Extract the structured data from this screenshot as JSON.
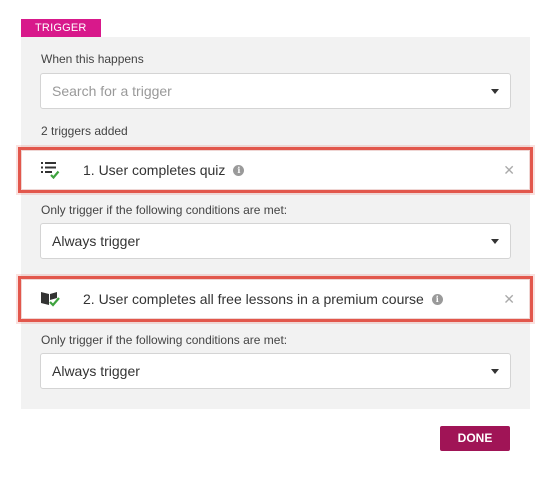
{
  "tag": {
    "label": "TRIGGER"
  },
  "when": {
    "label": "When this happens",
    "search": {
      "placeholder": "Search for a trigger"
    }
  },
  "added_count_label": "2 triggers added",
  "triggers": [
    {
      "name": "1. User completes quiz",
      "icon": "quiz-list-icon",
      "condition_label": "Only trigger if the following conditions are met:",
      "condition_value": "Always trigger"
    },
    {
      "name": "2. User completes all free lessons in a premium course",
      "icon": "book-lessons-icon",
      "condition_label": "Only trigger if the following conditions are met:",
      "condition_value": "Always trigger"
    }
  ],
  "actions": {
    "done_label": "DONE"
  },
  "colors": {
    "tag": "#d8198b",
    "done": "#a01456",
    "highlight": "#e2574c",
    "icon_dark": "#333333",
    "icon_green": "#3fa33f"
  }
}
